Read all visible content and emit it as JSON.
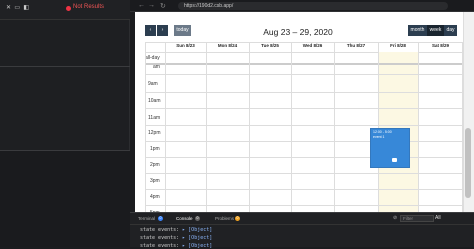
{
  "left_panel": {
    "tab_label": "Not Results"
  },
  "browser": {
    "url": "https://190d2.csb.app/"
  },
  "toolbar": {
    "prev": "‹",
    "next": "›",
    "today": "today",
    "title": "Aug 23 – 29, 2020",
    "views": [
      "month",
      "week",
      "day"
    ]
  },
  "calendar": {
    "columns": [
      "Sun 8/23",
      "Mon 8/24",
      "Tue 8/25",
      "Wed 8/26",
      "Thu 8/27",
      "Fri 8/28",
      "Sat 8/29"
    ],
    "allday": "all-day",
    "times": [
      "9am",
      "10am",
      "11am",
      "12pm",
      "1pm",
      "2pm",
      "3pm",
      "4pm",
      "5pm",
      "6pm"
    ],
    "first_time_fragment": "am",
    "event": {
      "time": "12:00 - 5:00",
      "title": "event 1"
    }
  },
  "devtools": {
    "tabs": [
      {
        "label": "Terminal",
        "badge": "0"
      },
      {
        "label": "Console",
        "badge": "0"
      },
      {
        "label": "Problems",
        "badge": "0"
      }
    ],
    "filter_placeholder": "Filter",
    "level": "All",
    "lines": [
      {
        "key": "state events:",
        "value": "▸ [Object]"
      },
      {
        "key": "state events:",
        "value": "▸ [Object]"
      },
      {
        "key": "state events:",
        "value": "▸ [Object]"
      }
    ]
  },
  "colors": {
    "event": "#3788d8",
    "today_bg": "#fcf8e3",
    "toolbar_btn": "#2c3e50"
  }
}
